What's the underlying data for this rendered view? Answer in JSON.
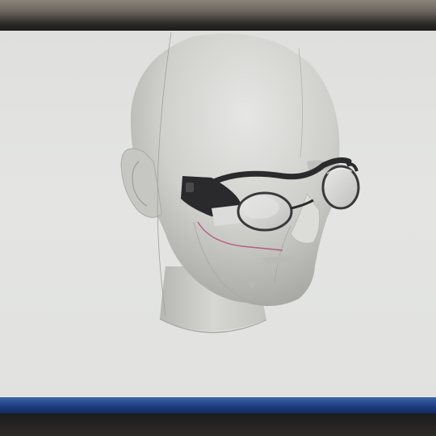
{
  "scene": {
    "description_icon": "3d-head-model-with-smart-glasses",
    "colors": {
      "viewport_bg": "#e2e3e1",
      "head_fill": "#cfd0cc",
      "head_shadow": "#a9aaa6",
      "glasses_frame": "#2b2b2d",
      "lens": "#d5d6d4",
      "cable": "#b0407a",
      "taskbar": "#1e3e82"
    }
  },
  "toolbar": {
    "faint_text": "",
    "icons": [
      "toolbar-icon-1",
      "toolbar-icon-2",
      "toolbar-icon-3"
    ]
  }
}
